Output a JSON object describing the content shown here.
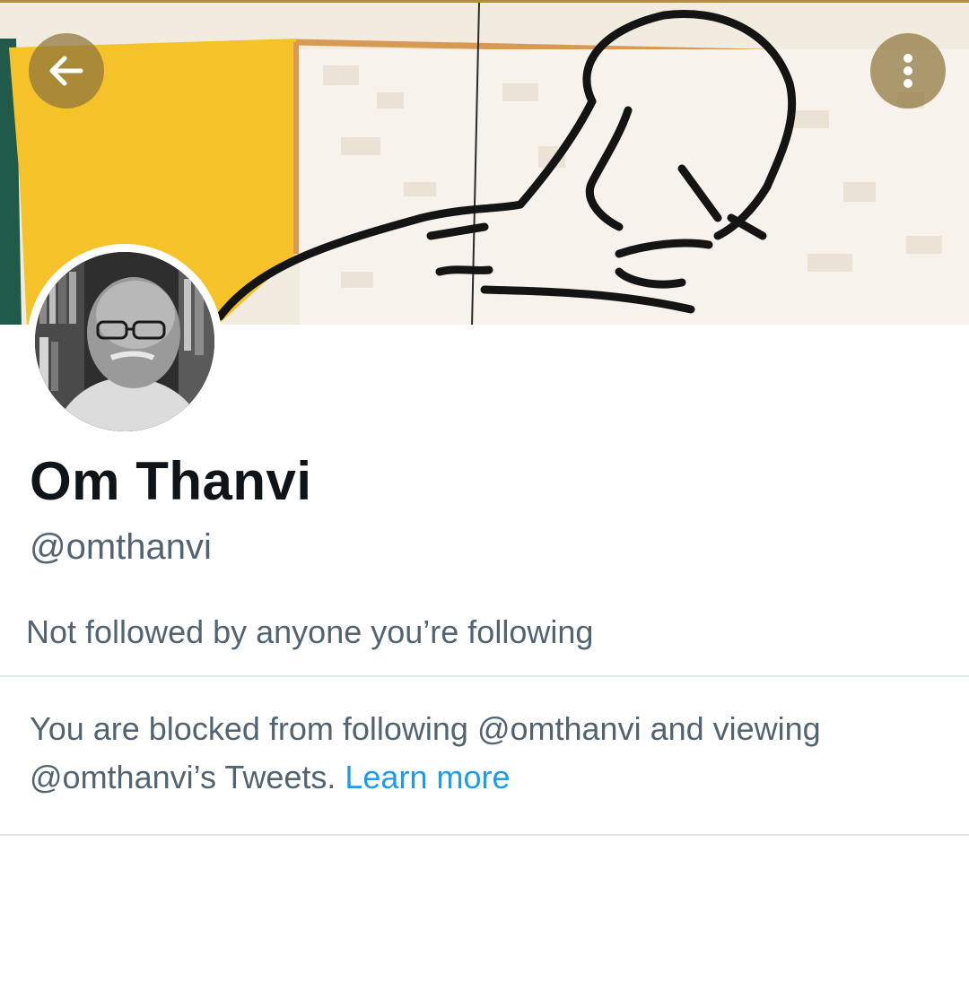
{
  "header": {
    "back_icon": "arrow-left-icon",
    "more_icon": "more-vertical-icon"
  },
  "profile": {
    "display_name": "Om Thanvi",
    "handle": "@omthanvi",
    "followers_note": "Not followed by anyone you’re following"
  },
  "blocked_notice": {
    "line1": "You are blocked from following @omthanvi and viewing",
    "line2": "@omthanvi’s Tweets.",
    "learn_more": "Learn more"
  },
  "colors": {
    "primary_text": "#0f1419",
    "secondary_text": "#536471",
    "link": "#1d9bf0",
    "divider": "#e1e6ea"
  }
}
